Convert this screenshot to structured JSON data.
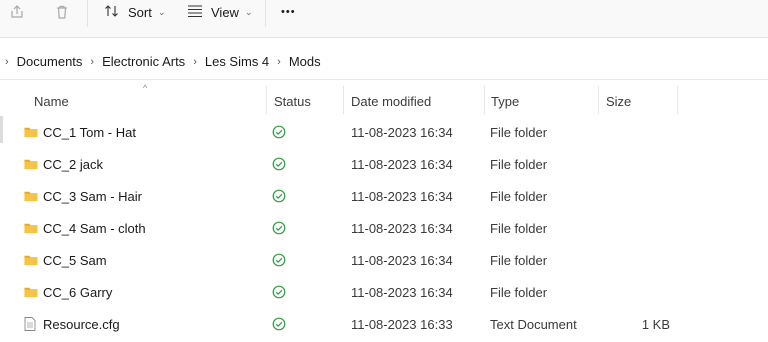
{
  "toolbar": {
    "sort_label": "Sort",
    "view_label": "View",
    "more_label": "•••"
  },
  "breadcrumb": {
    "items": [
      "Documents",
      "Electronic Arts",
      "Les Sims 4",
      "Mods"
    ]
  },
  "columns": {
    "name": "Name",
    "status": "Status",
    "date_modified": "Date modified",
    "type": "Type",
    "size": "Size"
  },
  "files": [
    {
      "name": "CC_1 Tom - Hat",
      "icon": "folder-icon",
      "date": "11-08-2023 16:34",
      "type": "File folder",
      "size": ""
    },
    {
      "name": "CC_2 jack",
      "icon": "folder-icon",
      "date": "11-08-2023 16:34",
      "type": "File folder",
      "size": ""
    },
    {
      "name": "CC_3 Sam - Hair",
      "icon": "folder-icon",
      "date": "11-08-2023 16:34",
      "type": "File folder",
      "size": ""
    },
    {
      "name": "CC_4 Sam - cloth",
      "icon": "folder-icon",
      "date": "11-08-2023 16:34",
      "type": "File folder",
      "size": ""
    },
    {
      "name": "CC_5 Sam",
      "icon": "folder-icon",
      "date": "11-08-2023 16:34",
      "type": "File folder",
      "size": ""
    },
    {
      "name": "CC_6 Garry",
      "icon": "folder-icon",
      "date": "11-08-2023 16:34",
      "type": "File folder",
      "size": ""
    },
    {
      "name": "Resource.cfg",
      "icon": "document-icon",
      "date": "11-08-2023 16:33",
      "type": "Text Document",
      "size": "1 KB"
    }
  ],
  "colors": {
    "folder": "#f5c445",
    "folder_dark": "#e3a922",
    "status_green": "#2e9e44"
  }
}
